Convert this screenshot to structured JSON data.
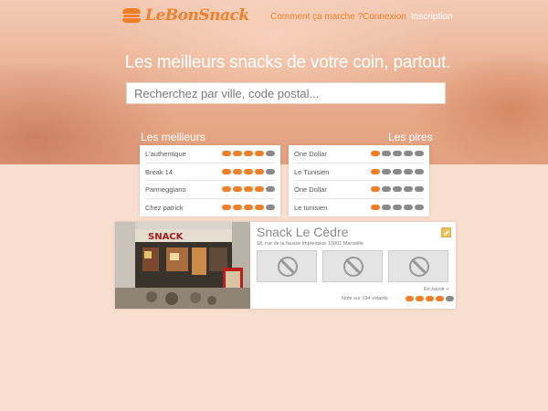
{
  "app": {
    "logo_text": "LeBonSnack",
    "accent_color": "#f07f2a"
  },
  "nav": {
    "how_it_works": "Comment ça marche ?",
    "login": "Connexion",
    "signup": "Inscription"
  },
  "hero": {
    "tagline": "Les meilleurs snacks de votre coin, partout.",
    "search_placeholder": "Recherchez par ville, code postal..."
  },
  "rankings": {
    "best_title": "Les meilleurs",
    "worst_title": "Les pires",
    "best": [
      {
        "name": "L'authentique",
        "rating": 4
      },
      {
        "name": "Break 14",
        "rating": 4
      },
      {
        "name": "Parmeggiano",
        "rating": 4
      },
      {
        "name": "Chez patrick",
        "rating": 4
      }
    ],
    "worst": [
      {
        "name": "One Dollar",
        "rating": 1
      },
      {
        "name": "Le Tunisien",
        "rating": 1
      },
      {
        "name": "One Dollar",
        "rating": 1
      },
      {
        "name": "Le tunisien",
        "rating": 1
      }
    ]
  },
  "featured": {
    "name": "Snack Le Cèdre",
    "address": "18, rue de la fausse impression 13001 Marseille",
    "photo_sign": "SNACK",
    "more_link": "En savoir +",
    "vote_label": "Note sur 194 votants :",
    "rating": 4,
    "rating_max": 5
  }
}
